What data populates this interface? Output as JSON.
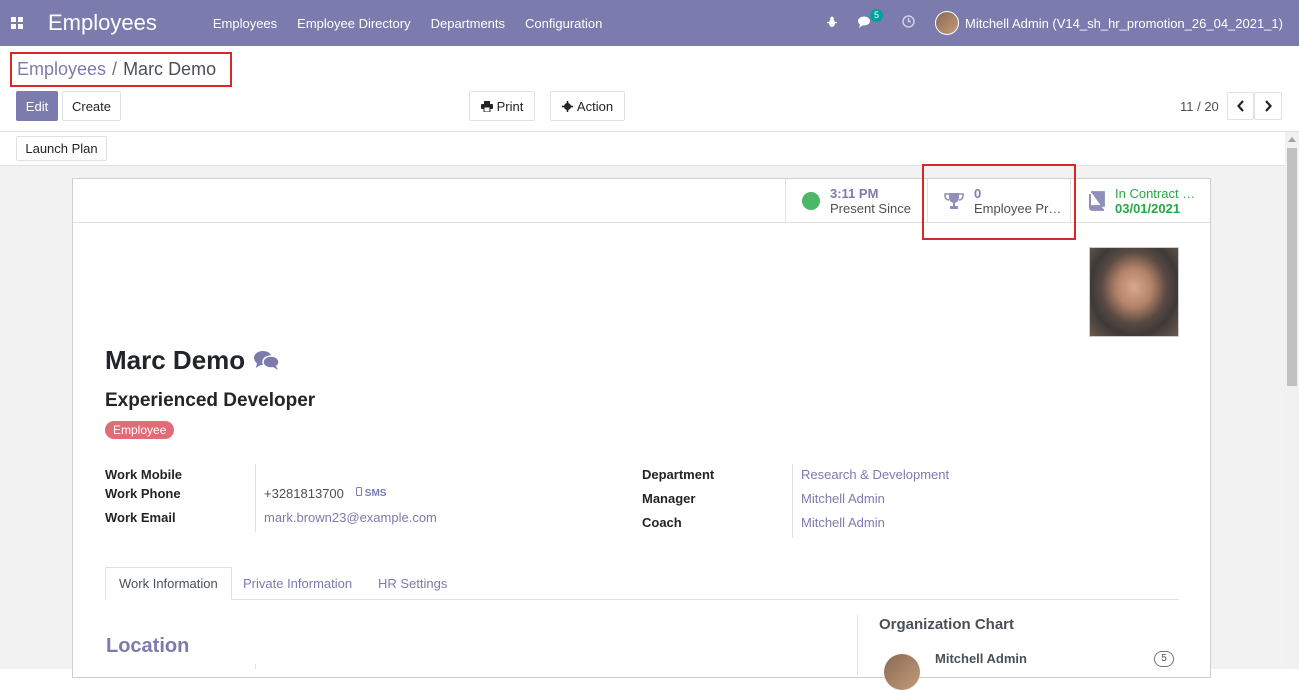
{
  "navbar": {
    "app_title": "Employees",
    "menu": [
      "Employees",
      "Employee Directory",
      "Departments",
      "Configuration"
    ],
    "messages_badge": "5",
    "user_label": "Mitchell Admin (V14_sh_hr_promotion_26_04_2021_1)",
    "bg_color": "#7c7bad"
  },
  "breadcrumb": {
    "parent": "Employees",
    "separator": "/",
    "current": "Marc Demo"
  },
  "toolbar": {
    "edit_label": "Edit",
    "create_label": "Create",
    "print_label": "Print",
    "action_label": "Action",
    "pager": "11 / 20",
    "launch_plan_label": "Launch Plan"
  },
  "stat_buttons": {
    "presence": {
      "value": "3:11 PM",
      "label": "Present Since"
    },
    "promotion": {
      "value": "0",
      "label": "Employee Pr…"
    },
    "contract": {
      "value": "In Contract …",
      "date": "03/01/2021"
    }
  },
  "employee": {
    "name": "Marc Demo",
    "job_title": "Experienced Developer",
    "tag": "Employee"
  },
  "fields_left": {
    "work_mobile_label": "Work Mobile",
    "work_phone_label": "Work Phone",
    "work_phone_value": "+3281813700",
    "sms_label": "SMS",
    "work_email_label": "Work Email",
    "work_email_value": "mark.brown23@example.com"
  },
  "fields_right": {
    "department_label": "Department",
    "department_value": "Research & Development",
    "manager_label": "Manager",
    "manager_value": "Mitchell Admin",
    "coach_label": "Coach",
    "coach_value": "Mitchell Admin"
  },
  "tabs": [
    "Work Information",
    "Private Information",
    "HR Settings"
  ],
  "work_info": {
    "location_title": "Location",
    "org_chart_title": "Organization Chart",
    "org_manager_name": "Mitchell Admin",
    "org_manager_count": "5"
  }
}
